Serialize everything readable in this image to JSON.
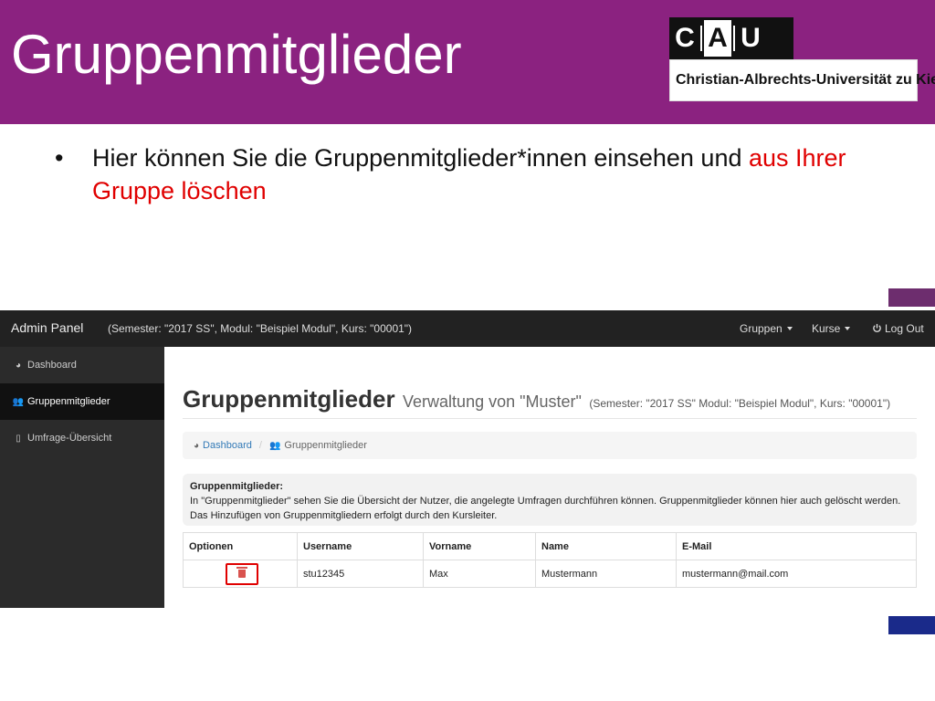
{
  "slide": {
    "title": "Gruppenmitglieder",
    "logo": {
      "letters": [
        "C",
        "A",
        "U"
      ],
      "name": "Christian-Albrechts-Universität zu Kiel"
    },
    "bullet": {
      "text": "Hier können Sie die Gruppenmitglieder*innen einsehen und ",
      "highlight": "aus Ihrer Gruppe löschen"
    },
    "colors": {
      "header": "#8b2280",
      "highlight": "#e00000"
    }
  },
  "app": {
    "brand": "Admin Panel",
    "context": "(Semester: \"2017 SS\", Modul: \"Beispiel Modul\", Kurs: \"00001\")",
    "nav": {
      "groups": "Gruppen",
      "courses": "Kurse",
      "logout": "Log Out"
    },
    "sidebar": {
      "items": [
        {
          "label": "Dashboard",
          "icon": "dashboard-icon"
        },
        {
          "label": "Gruppenmitglieder",
          "icon": "users-icon"
        },
        {
          "label": "Umfrage-Übersicht",
          "icon": "file-icon"
        }
      ]
    },
    "page": {
      "title": "Gruppenmitglieder",
      "subtitle": "Verwaltung von \"Muster\"",
      "context": "(Semester: \"2017 SS\" Modul: \"Beispiel Modul\", Kurs: \"00001\")"
    },
    "breadcrumb": {
      "home": "Dashboard",
      "current": "Gruppenmitglieder"
    },
    "info": {
      "title": "Gruppenmitglieder:",
      "text": "In \"Gruppenmitglieder\" sehen Sie die Übersicht der Nutzer, die angelegte Umfragen durchführen können. Gruppenmitglieder können hier auch gelöscht werden. Das Hinzufügen von Gruppenmitgliedern erfolgt durch den Kursleiter."
    },
    "table": {
      "columns": [
        "Optionen",
        "Username",
        "Vorname",
        "Name",
        "E-Mail"
      ],
      "rows": [
        {
          "username": "stu12345",
          "first_name": "Max",
          "last_name": "Mustermann",
          "email": "mustermann@mail.com"
        }
      ]
    }
  }
}
